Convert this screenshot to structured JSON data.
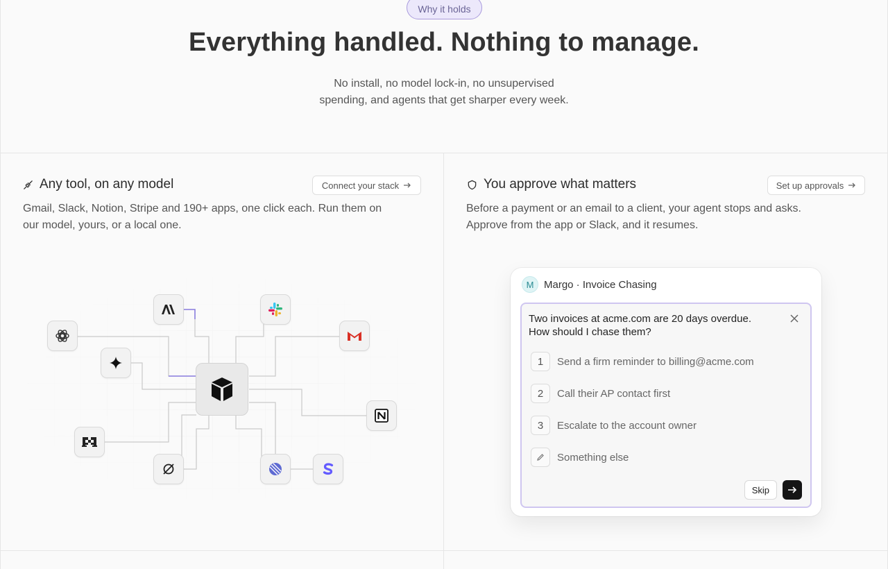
{
  "header": {
    "badge": "Why it holds",
    "title": "Everything handled. Nothing to manage.",
    "subtitle_line1": "No install, no model lock-in, no unsupervised",
    "subtitle_line2": "spending, and agents that get sharper every week."
  },
  "left_card": {
    "icon": "plug-icon",
    "title": "Any tool, on any model",
    "button": "Connect your stack",
    "desc_line1": "Gmail, Slack, Notion, Stripe and 190+ apps, one click each. Run them on",
    "desc_line2": "our model, yours, or a local one."
  },
  "right_card": {
    "icon": "shield-icon",
    "title": "You approve what matters",
    "button": "Set up approvals",
    "desc_line1": "Before a payment or an email to a client, your agent stops and asks.",
    "desc_line2": "Approve from the app or Slack, and it resumes."
  },
  "approval": {
    "avatar": "M",
    "agent": "Margo · Invoice Chasing",
    "question_line1": "Two invoices at acme.com are 20 days overdue.",
    "question_line2": "How should I chase them?",
    "options": [
      {
        "num": "1",
        "label": "Send a firm reminder to billing@acme.com"
      },
      {
        "num": "2",
        "label": "Call their AP contact first"
      },
      {
        "num": "3",
        "label": "Escalate to the account owner"
      },
      {
        "num": "",
        "label": "Something else"
      }
    ],
    "skip": "Skip"
  },
  "integrations": [
    "anthropic-icon",
    "openai-icon",
    "gemini-icon",
    "mistral-icon",
    "ollama-icon",
    "slack-icon",
    "gmail-icon",
    "notion-icon",
    "linear-icon",
    "stripe-icon"
  ],
  "colors": {
    "accent": "#7c6cd6",
    "badge_bg": "#ece8fb",
    "stripe": "#635bff",
    "gmail": "#d93025"
  }
}
